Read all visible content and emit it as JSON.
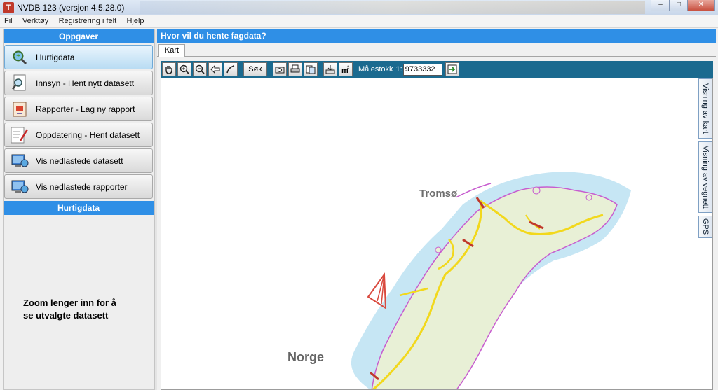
{
  "window": {
    "title": "NVDB 123 (versjon 4.5.28.0)",
    "app_icon_letter": "T"
  },
  "menu": [
    "Fil",
    "Verktøy",
    "Registrering i felt",
    "Hjelp"
  ],
  "left_panel": {
    "header": "Oppgaver",
    "tasks": [
      {
        "label": "Hurtigdata",
        "icon": "magnifier-globe-icon"
      },
      {
        "label": "Innsyn - Hent nytt datasett",
        "icon": "document-search-icon"
      },
      {
        "label": "Rapporter - Lag ny rapport",
        "icon": "report-icon"
      },
      {
        "label": "Oppdatering - Hent datasett",
        "icon": "edit-document-icon"
      },
      {
        "label": "Vis nedlastede datasett",
        "icon": "computer-globe-icon"
      },
      {
        "label": "Vis nedlastede rapporter",
        "icon": "computer-globe-icon"
      }
    ],
    "section_header": "Hurtigdata",
    "info_text": "Zoom lenger inn for å se utvalgte datasett"
  },
  "right_panel": {
    "header": "Hvor vil du hente fagdata?",
    "tab": "Kart",
    "toolbar": {
      "search_label": "Søk",
      "scale_label": "Målestokk",
      "scale_prefix": "1:",
      "scale_value": "9733332"
    },
    "side_tabs": [
      "Visning av kart",
      "Visning av vegnett",
      "GPS"
    ],
    "map_labels": {
      "city": "Tromsø",
      "country": "Norge"
    }
  },
  "colors": {
    "header_blue": "#2f8fe6",
    "toolbar_teal": "#1b6a8f",
    "sea": "#bfe3f2",
    "land": "#e9f1d9",
    "road_yellow": "#f2d81c",
    "road_red": "#c0392b",
    "border_magenta": "#c35ccf"
  }
}
